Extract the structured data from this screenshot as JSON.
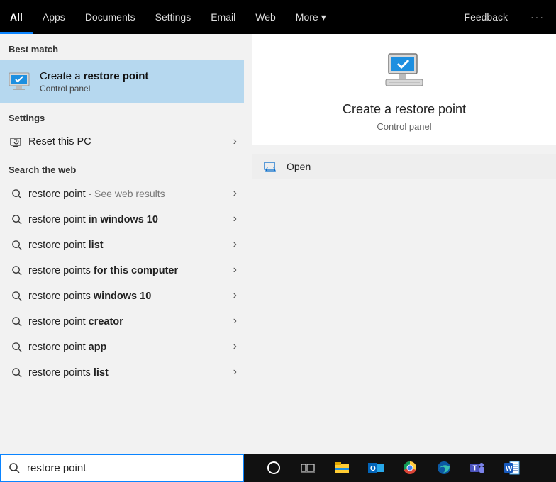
{
  "topbar": {
    "tabs": {
      "all": "All",
      "apps": "Apps",
      "documents": "Documents",
      "settings": "Settings",
      "email": "Email",
      "web": "Web",
      "more": "More"
    },
    "feedback": "Feedback"
  },
  "left": {
    "best_match_label": "Best match",
    "best_match": {
      "title_plain": "Create a ",
      "title_bold": "restore point",
      "sub": "Control panel"
    },
    "settings_label": "Settings",
    "reset_pc": "Reset this PC",
    "web_label": "Search the web",
    "web_rows": [
      {
        "plain": "restore point",
        "bold": "",
        "extra": " - See web results"
      },
      {
        "plain": "restore point ",
        "bold": "in windows 10",
        "extra": ""
      },
      {
        "plain": "restore point ",
        "bold": "list",
        "extra": ""
      },
      {
        "plain": "restore points ",
        "bold": "for this computer",
        "extra": ""
      },
      {
        "plain": "restore points ",
        "bold": "windows 10",
        "extra": ""
      },
      {
        "plain": "restore point ",
        "bold": "creator",
        "extra": ""
      },
      {
        "plain": "restore point ",
        "bold": "app",
        "extra": ""
      },
      {
        "plain": "restore points ",
        "bold": "list",
        "extra": ""
      }
    ]
  },
  "right": {
    "title": "Create a restore point",
    "sub": "Control panel",
    "open": "Open"
  },
  "search": {
    "value": "restore point"
  }
}
